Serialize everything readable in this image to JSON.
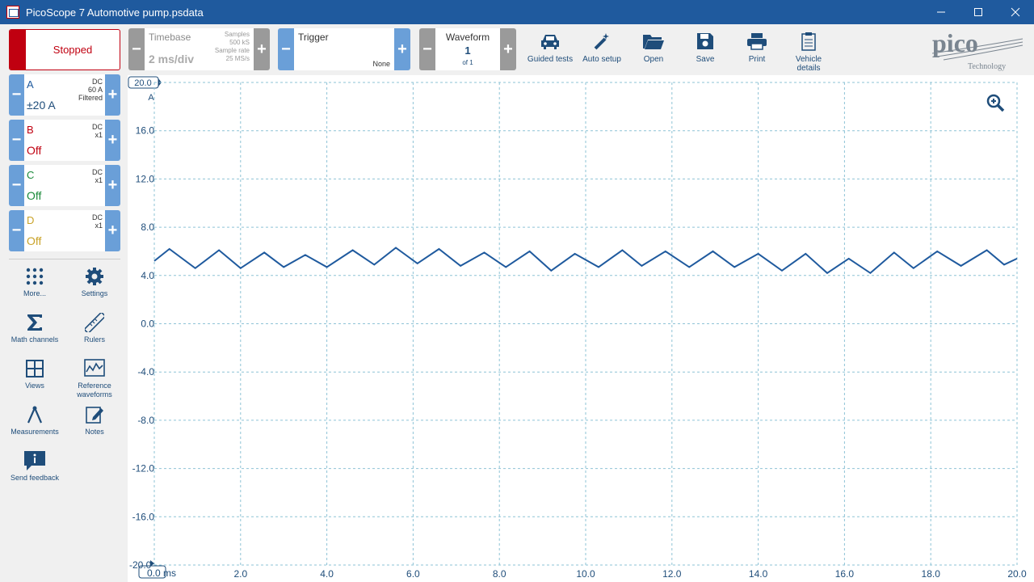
{
  "window": {
    "title": "PicoScope 7 Automotive pump.psdata"
  },
  "runstop": {
    "label": "Stopped"
  },
  "timebase": {
    "label": "Timebase",
    "value": "2 ms/div",
    "samples_label": "Samples",
    "samples_value": "500 kS",
    "rate_label": "Sample rate",
    "rate_value": "25 MS/s"
  },
  "trigger": {
    "label": "Trigger",
    "mode": "None"
  },
  "waveform": {
    "label": "Waveform",
    "current": "1",
    "of": "of 1"
  },
  "toolbar": [
    {
      "label": "Guided tests",
      "icon": "car-icon"
    },
    {
      "label": "Auto setup",
      "icon": "wand-icon"
    },
    {
      "label": "Open",
      "icon": "folder-icon"
    },
    {
      "label": "Save",
      "icon": "floppy-icon"
    },
    {
      "label": "Print",
      "icon": "printer-icon"
    },
    {
      "label": "Vehicle details",
      "icon": "clipboard-icon"
    }
  ],
  "logo": {
    "text": "pico",
    "sub": "Technology"
  },
  "channels": [
    {
      "name": "A",
      "coupling": "DC",
      "probe": "60 A",
      "filter": "Filtered",
      "value": "±20 A",
      "color": "#1f5a9e"
    },
    {
      "name": "B",
      "coupling": "DC",
      "probe": "x1",
      "filter": "",
      "value": "Off",
      "color": "#c00010"
    },
    {
      "name": "C",
      "coupling": "DC",
      "probe": "x1",
      "filter": "",
      "value": "Off",
      "color": "#1a8a3a"
    },
    {
      "name": "D",
      "coupling": "DC",
      "probe": "x1",
      "filter": "",
      "value": "Off",
      "color": "#c9a227"
    }
  ],
  "side_tools": [
    {
      "label": "More...",
      "icon": "grid-dots-icon"
    },
    {
      "label": "Settings",
      "icon": "gear-icon"
    },
    {
      "label": "Math channels",
      "icon": "sigma-icon"
    },
    {
      "label": "Rulers",
      "icon": "ruler-icon"
    },
    {
      "label": "Views",
      "icon": "views-icon"
    },
    {
      "label": "Reference waveforms",
      "icon": "reference-waveform-icon"
    },
    {
      "label": "Measurements",
      "icon": "measurement-icon"
    },
    {
      "label": "Notes",
      "icon": "notes-icon"
    },
    {
      "label": "Send feedback",
      "icon": "feedback-icon"
    }
  ],
  "scope": {
    "y_range_label": "20.0",
    "y_unit": "A",
    "y_ticks": [
      "16.0",
      "12.0",
      "8.0",
      "4.0",
      "0.0",
      "-4.0",
      "-8.0",
      "-12.0",
      "-16.0"
    ],
    "y_bottom_label": "-20.0",
    "x_ticks": [
      "2.0",
      "4.0",
      "6.0",
      "8.0",
      "10.0",
      "12.0",
      "14.0",
      "16.0",
      "18.0",
      "20.0"
    ],
    "x_first_label": "0.0 ms",
    "trace_color": "#1f5a9e",
    "grid_color": "#8ec3d6"
  },
  "chart_data": {
    "type": "line",
    "xlim": [
      0,
      20
    ],
    "ylim": [
      -20,
      20
    ],
    "xlabel": "ms",
    "ylabel": "A",
    "grid": true,
    "series": [
      {
        "name": "A",
        "x": [
          0.0,
          0.35,
          0.95,
          1.5,
          2.0,
          2.55,
          3.0,
          3.5,
          4.0,
          4.6,
          5.1,
          5.6,
          6.1,
          6.6,
          7.1,
          7.65,
          8.15,
          8.7,
          9.2,
          9.75,
          10.3,
          10.85,
          11.3,
          11.85,
          12.4,
          12.95,
          13.45,
          14.0,
          14.55,
          15.1,
          15.6,
          16.1,
          16.6,
          17.15,
          17.6,
          18.15,
          18.7,
          19.3,
          19.7,
          20.0
        ],
        "y": [
          5.2,
          6.2,
          4.6,
          6.1,
          4.6,
          5.9,
          4.7,
          5.7,
          4.7,
          6.1,
          4.9,
          6.3,
          5.0,
          6.2,
          4.8,
          5.9,
          4.7,
          6.0,
          4.4,
          5.8,
          4.7,
          6.1,
          4.8,
          6.0,
          4.7,
          6.0,
          4.7,
          5.8,
          4.4,
          5.8,
          4.2,
          5.4,
          4.2,
          5.9,
          4.6,
          6.0,
          4.8,
          6.1,
          4.9,
          5.4
        ]
      }
    ]
  }
}
